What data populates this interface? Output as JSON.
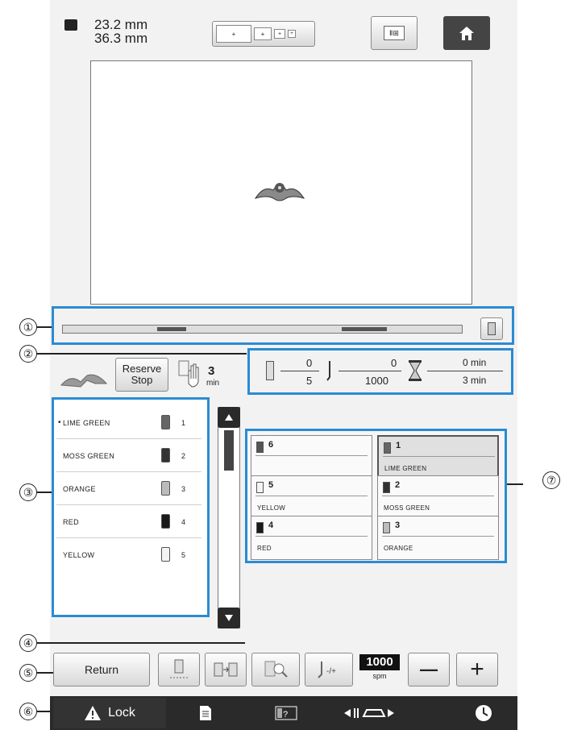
{
  "header": {
    "size_w": "23.2 mm",
    "size_h": "36.3 mm",
    "frame_icon": "frame-size-icon",
    "view_button_label": "Ⅱ⊞",
    "home_icon": "home-icon"
  },
  "progress": {
    "callout": "①",
    "value": 0.0
  },
  "status": {
    "callout": "②",
    "reserve_stop_label": "Reserve\nStop",
    "stop_time": "3",
    "stop_unit": "min",
    "color_count_num": "0",
    "color_count_den": "5",
    "stitch_num": "0",
    "stitch_den": "1000",
    "time_num": "0 min",
    "time_den": "3 min"
  },
  "threads": {
    "callout": "③",
    "items": [
      {
        "name": "LIME GREEN",
        "no": "1",
        "color": "#666666",
        "marker": "•"
      },
      {
        "name": "MOSS GREEN",
        "no": "2",
        "color": "#333333"
      },
      {
        "name": "ORANGE",
        "no": "3",
        "color": "#bbbbbb"
      },
      {
        "name": "RED",
        "no": "4",
        "color": "#1a1a1a"
      },
      {
        "name": "YELLOW",
        "no": "5",
        "color": "#f4f4f4"
      }
    ]
  },
  "scroll": {
    "callout": "④"
  },
  "needles": {
    "callout": "⑦",
    "cells": [
      {
        "no": "6",
        "label": "",
        "color": "#555555"
      },
      {
        "no": "1",
        "label": "LIME GREEN",
        "color": "#666666"
      },
      {
        "no": "5",
        "label": "YELLOW",
        "color": "#f4f4f4"
      },
      {
        "no": "2",
        "label": "MOSS GREEN",
        "color": "#333333"
      },
      {
        "no": "4",
        "label": "RED",
        "color": "#1a1a1a"
      },
      {
        "no": "3",
        "label": "ORANGE",
        "color": "#bbbbbb"
      }
    ]
  },
  "toolbar": {
    "callout": "⑤",
    "return_label": "Return",
    "speed_value": "1000",
    "speed_unit": "spm",
    "minus_label": "—",
    "plus_label": "+"
  },
  "bottombar": {
    "callout": "⑥",
    "lock_label": "Lock",
    "warning_icon": "warning-icon",
    "doc_icon": "document-icon",
    "help_icon": "help-icon",
    "frame_move_icon": "frame-move-icon",
    "clock_icon": "clock-icon"
  },
  "colors": {
    "accent": "#2b8bd3",
    "dark_bar": "#2a2a2a"
  }
}
